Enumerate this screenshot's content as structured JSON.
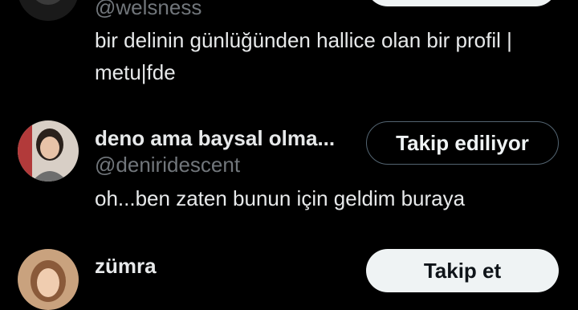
{
  "colors": {
    "background": "#000000",
    "primary_text": "#e7e9ea",
    "secondary_text": "#71767b",
    "follow_button_bg": "#eff3f4",
    "following_button_border": "#536471"
  },
  "users": [
    {
      "handle": "@welsness",
      "bio": "bir delinin günlüğünden hallice olan bir profil | metu|fde",
      "button_label": ""
    },
    {
      "display_name": "deno ama baysal olma...",
      "handle": "@deniridescent",
      "bio": "oh...ben zaten bunun için geldim buraya",
      "button_label": "Takip ediliyor"
    },
    {
      "display_name": "zümra",
      "button_label": "Takip et"
    }
  ]
}
